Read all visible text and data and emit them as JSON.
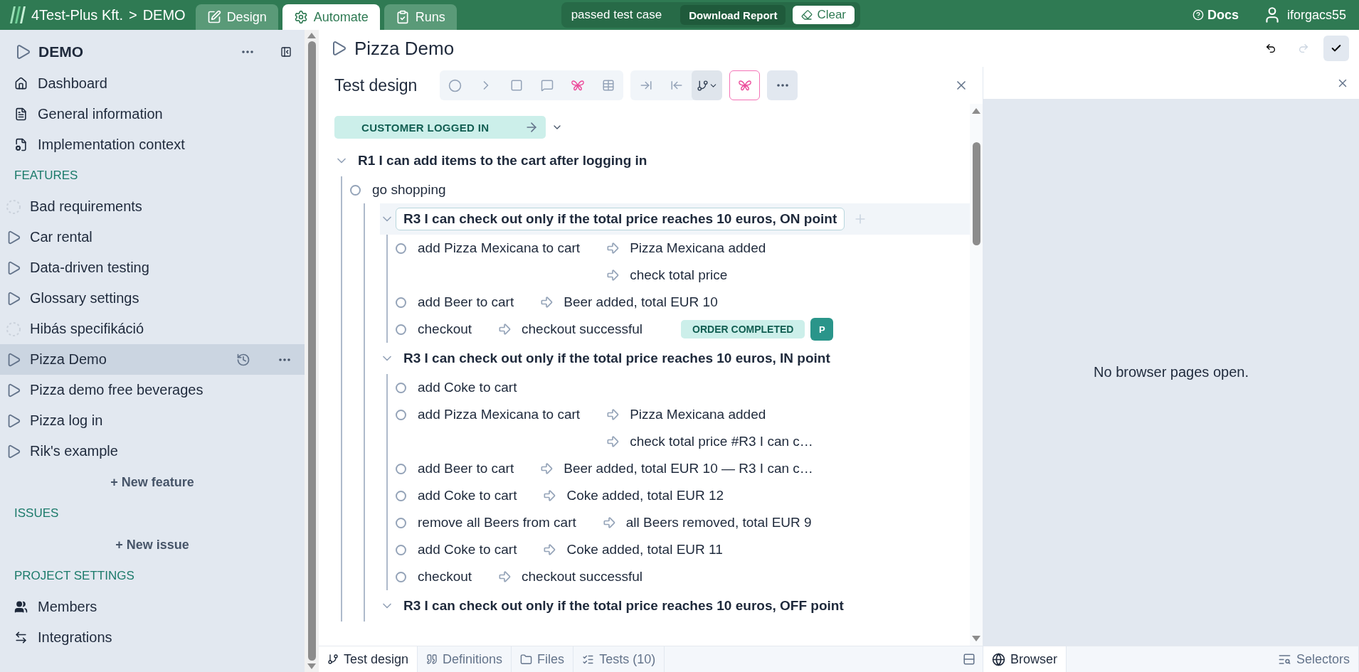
{
  "topbar": {
    "organization": "4Test-Plus Kft.",
    "separator": ">",
    "project": "DEMO",
    "tabs": [
      {
        "label": "Design",
        "kind": "design",
        "selected": false
      },
      {
        "label": "Automate",
        "kind": "automate",
        "selected": true
      },
      {
        "label": "Runs",
        "kind": "runs",
        "selected": false
      }
    ],
    "status": {
      "message": "passed test case",
      "download": "Download Report",
      "clear": "Clear"
    },
    "docs": "Docs",
    "user": "iforgacs55"
  },
  "sidebar": {
    "project": "DEMO",
    "nav": [
      {
        "label": "Dashboard",
        "kind": "dashboard"
      },
      {
        "label": "General information",
        "kind": "document"
      },
      {
        "label": "Implementation context",
        "kind": "context"
      }
    ],
    "features": {
      "heading": "FEATURES",
      "add": "+ New feature",
      "items": [
        {
          "label": "Bad requirements",
          "kind": "draft",
          "selected": false
        },
        {
          "label": "Car rental",
          "kind": "feature",
          "selected": false
        },
        {
          "label": "Data-driven testing",
          "kind": "feature",
          "selected": false
        },
        {
          "label": "Glossary settings",
          "kind": "feature",
          "selected": false
        },
        {
          "label": "Hibás specifikáció",
          "kind": "draft",
          "selected": false
        },
        {
          "label": "Pizza Demo",
          "kind": "feature",
          "selected": true
        },
        {
          "label": "Pizza demo free beverages",
          "kind": "feature",
          "selected": false
        },
        {
          "label": "Pizza log in",
          "kind": "feature",
          "selected": false
        },
        {
          "label": "Rik's example",
          "kind": "feature",
          "selected": false
        }
      ]
    },
    "issues": {
      "heading": "ISSUES",
      "add": "+ New issue"
    },
    "settings": {
      "heading": "PROJECT SETTINGS",
      "items": [
        {
          "label": "Members",
          "kind": "members"
        },
        {
          "label": "Integrations",
          "kind": "integrations"
        }
      ]
    }
  },
  "editor": {
    "title": "Pizza Demo",
    "toolbar": {
      "title": "Test design",
      "branch_menu": {
        "selected": true
      }
    },
    "tree": [
      {
        "kind": "tag",
        "label": "CUSTOMER LOGGED IN"
      },
      {
        "kind": "requirement",
        "title": "R1 I can add items to the cart after logging in",
        "expanded": true,
        "selected": false,
        "children": [
          {
            "kind": "step",
            "action": "go shopping",
            "children": [
              {
                "kind": "requirement",
                "title": "R3 I can check out only if the total price reaches 10 euros, ON point",
                "expanded": true,
                "selected": true,
                "children": [
                  {
                    "kind": "step",
                    "action": "add Pizza Mexicana to cart",
                    "results": [
                      "Pizza Mexicana added",
                      "check total price"
                    ]
                  },
                  {
                    "kind": "step",
                    "action": "add Beer to cart",
                    "results": [
                      "Beer added, total EUR 10"
                    ]
                  },
                  {
                    "kind": "step",
                    "action": "checkout",
                    "results": [
                      "checkout successful"
                    ],
                    "tag": "ORDER COMPLETED",
                    "avatar": "P"
                  }
                ]
              },
              {
                "kind": "requirement",
                "title": "R3 I can check out only if the total price reaches 10 euros, IN point",
                "expanded": true,
                "selected": false,
                "children": [
                  {
                    "kind": "step",
                    "action": "add Coke to cart"
                  },
                  {
                    "kind": "step",
                    "action": "add Pizza Mexicana to cart",
                    "results": [
                      "Pizza Mexicana added",
                      "check total price #R3 I can c…"
                    ]
                  },
                  {
                    "kind": "step",
                    "action": "add Beer to cart",
                    "results": [
                      "Beer added, total EUR 10 — R3 I can c…"
                    ]
                  },
                  {
                    "kind": "step",
                    "action": "add Coke to cart",
                    "results": [
                      "Coke added, total EUR 12"
                    ]
                  },
                  {
                    "kind": "step",
                    "action": "remove all Beers from cart",
                    "results": [
                      "all Beers removed, total EUR 9"
                    ]
                  },
                  {
                    "kind": "step",
                    "action": "add Coke to cart",
                    "results": [
                      "Coke added, total EUR 11"
                    ]
                  },
                  {
                    "kind": "step",
                    "action": "checkout",
                    "results": [
                      "checkout successful"
                    ]
                  }
                ]
              },
              {
                "kind": "requirement",
                "title": "R3 I can check out only if the total price reaches 10 euros, OFF point",
                "expanded": true,
                "selected": false
              }
            ]
          }
        ]
      }
    ],
    "tabs": [
      {
        "label": "Test design",
        "kind": "design",
        "selected": true
      },
      {
        "label": "Definitions",
        "kind": "definitions",
        "selected": false
      },
      {
        "label": "Files",
        "kind": "files",
        "selected": false
      },
      {
        "label": "Tests (10)",
        "kind": "tests",
        "selected": false
      }
    ]
  },
  "browser": {
    "message": "No browser pages open.",
    "tabs": [
      {
        "label": "Browser",
        "kind": "browser",
        "selected": true
      },
      {
        "label": "Selectors",
        "kind": "selectors",
        "selected": false
      }
    ]
  }
}
